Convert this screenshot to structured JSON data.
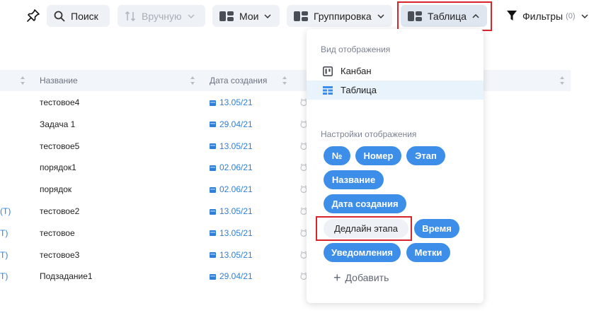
{
  "toolbar": {
    "search_label": "Поиск",
    "manual_label": "Вручную",
    "mine_label": "Мои",
    "grouping_label": "Группировка",
    "table_label": "Таблица",
    "filters_label": "Фильтры",
    "filters_count": "(0)"
  },
  "table": {
    "headers": {
      "name": "Название",
      "created": "Дата создания"
    },
    "rows": [
      {
        "prefix": "",
        "name": "тестовое4",
        "date": "13.05/21"
      },
      {
        "prefix": "",
        "name": "Задача 1",
        "date": "29.04/21"
      },
      {
        "prefix": "",
        "name": "тестовое5",
        "date": "13.05/21"
      },
      {
        "prefix": "",
        "name": "порядок1",
        "date": "02.06/21"
      },
      {
        "prefix": "",
        "name": "порядок",
        "date": "02.06/21"
      },
      {
        "prefix": "(Т)",
        "name": "тестовое2",
        "date": "13.05/21"
      },
      {
        "prefix": "Т)",
        "name": "тестовое",
        "date": "13.05/21"
      },
      {
        "prefix": "Т)",
        "name": "тестовое3",
        "date": "13.05/21"
      },
      {
        "prefix": "Т)",
        "name": "Подзадание1",
        "date": "29.04/21"
      }
    ]
  },
  "dropdown": {
    "view_title": "Вид отображения",
    "view_options": [
      {
        "label": "Канбан",
        "icon": "kanban-icon",
        "selected": false
      },
      {
        "label": "Таблица",
        "icon": "table-icon",
        "selected": true
      }
    ],
    "settings_title": "Настройки отображения",
    "chips": {
      "number_sign": "№",
      "number": "Номер",
      "stage": "Этап",
      "title": "Название",
      "created": "Дата создания",
      "stage_deadline": "Дедлайн этапа",
      "time": "Время",
      "notifications": "Уведомления",
      "tags": "Метки"
    },
    "add_label": "Добавить"
  },
  "colors": {
    "accent": "#3d8ee8",
    "date_text": "#2f7fd8",
    "highlight_border": "#d6262c",
    "toolbar_button_bg": "#eef1f5",
    "selected_option_bg": "#e8f3fb"
  }
}
